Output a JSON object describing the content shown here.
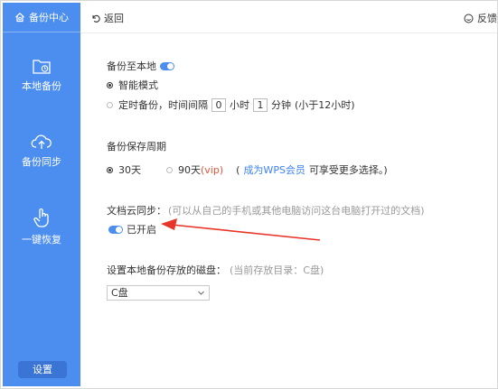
{
  "sidebar": {
    "header": "备份中心",
    "items": [
      {
        "label": "本地备份",
        "icon": "folder-clock-icon"
      },
      {
        "label": "备份同步",
        "icon": "cloud-upload-icon"
      },
      {
        "label": "一键恢复",
        "icon": "hand-pointer-icon"
      }
    ],
    "settings_label": "设置"
  },
  "topbar": {
    "back_label": "返回",
    "feedback_label": "反馈"
  },
  "local_backup": {
    "title": "备份至本地",
    "enabled": true,
    "smart_mode_label": "智能模式",
    "scheduled_prefix": "定时备份，时间间隔",
    "hours_value": "0",
    "hours_unit": "小时",
    "minutes_value": "1",
    "minutes_unit": "分钟",
    "limit_note": "(小于12小时)"
  },
  "retention": {
    "title": "备份保存周期",
    "opt_30": "30天",
    "opt_90": "90天",
    "vip_tag": "(vip)",
    "note_open": "(",
    "wps_link": "成为WPS会员",
    "note_rest": "可享受更多选择。)"
  },
  "cloud_sync": {
    "title": "文档云同步：",
    "description": "(可以从自己的手机或其他电脑访问这台电脑打开过的文档)",
    "status_label": "已开启",
    "enabled": true
  },
  "disk": {
    "title": "设置本地备份存放的磁盘：",
    "current_note": "(当前存放目录：C盘)",
    "selected": "C盘"
  },
  "colors": {
    "accent": "#4c8ef0",
    "annotation_arrow": "#e8352a"
  }
}
